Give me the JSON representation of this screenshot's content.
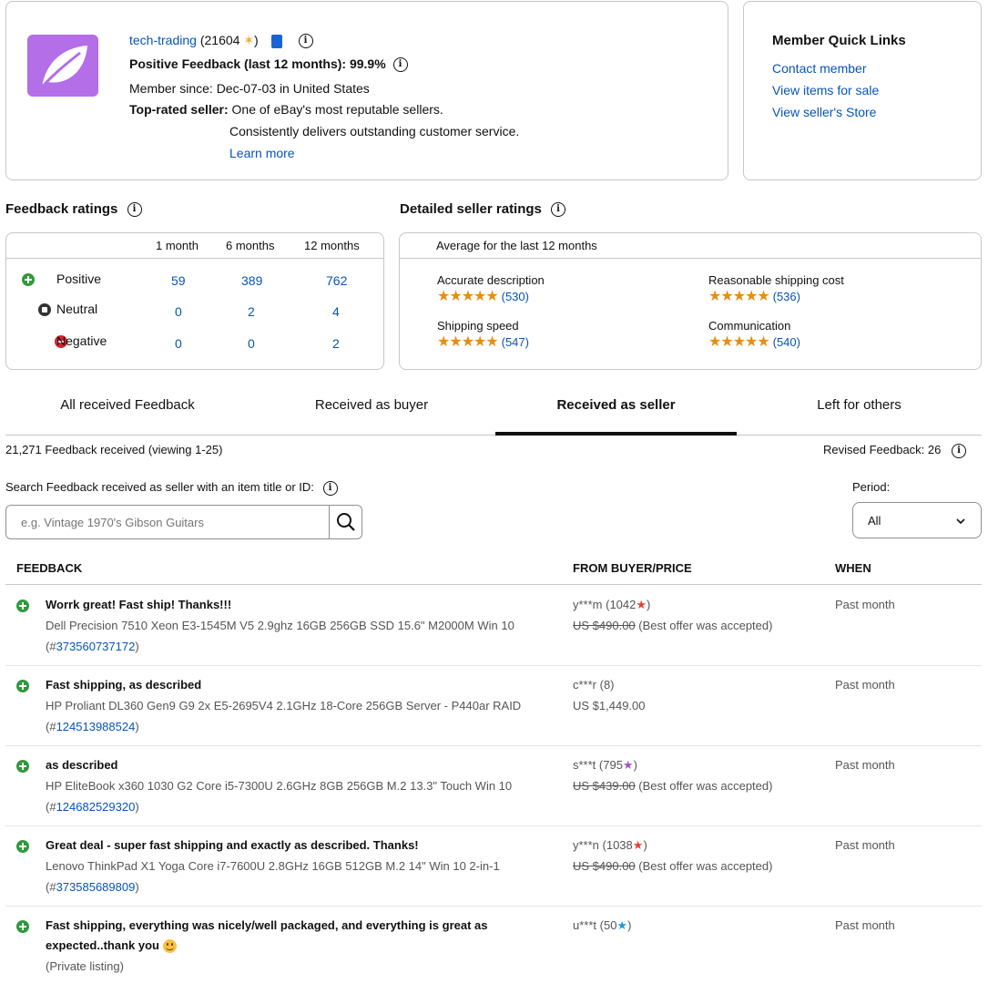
{
  "profile": {
    "username": "tech-trading",
    "score": "(21604",
    "score_close": ")",
    "positive_feedback": "Positive Feedback (last 12 months): 99.9%",
    "member_since": "Member since: Dec-07-03 in United States",
    "top_rated_label": "Top-rated seller:",
    "top_rated_line1": "One of eBay's most reputable sellers.",
    "top_rated_line2": "Consistently delivers outstanding customer service.",
    "learn_more": "Learn more",
    "avatar_color": "#b36ee8"
  },
  "quick_links": {
    "title": "Member Quick Links",
    "items": [
      "Contact member",
      "View items for sale",
      "View seller's Store"
    ]
  },
  "feedback_ratings": {
    "title": "Feedback ratings",
    "columns": [
      "1 month",
      "6 months",
      "12 months"
    ],
    "rows": [
      {
        "label": "Positive",
        "values": [
          "59",
          "389",
          "762"
        ]
      },
      {
        "label": "Neutral",
        "values": [
          "0",
          "2",
          "4"
        ]
      },
      {
        "label": "Negative",
        "values": [
          "0",
          "0",
          "2"
        ]
      }
    ]
  },
  "detailed_ratings": {
    "title": "Detailed seller ratings",
    "subtitle": "Average for the last 12 months",
    "items": [
      {
        "label": "Accurate description",
        "count": "(530)",
        "stars": 5
      },
      {
        "label": "Reasonable shipping cost",
        "count": "(536)",
        "stars": 5
      },
      {
        "label": "Shipping speed",
        "count": "(547)",
        "stars": 5
      },
      {
        "label": "Communication",
        "count": "(540)",
        "stars": 5
      }
    ]
  },
  "tabs": [
    "All received Feedback",
    "Received as buyer",
    "Received as seller",
    "Left for others"
  ],
  "active_tab": "Received as seller",
  "summary": {
    "count_text": "21,271 Feedback received (viewing 1-25)",
    "revised": "Revised Feedback: 26"
  },
  "search": {
    "label": "Search Feedback received as seller with an item title or ID:",
    "placeholder": "e.g. Vintage 1970's Gibson Guitars",
    "period_label": "Period:",
    "period_value": "All"
  },
  "table": {
    "headers": [
      "FEEDBACK",
      "FROM BUYER/PRICE",
      "WHEN"
    ],
    "rows": [
      {
        "comment": "Worrk great! Fast ship! Thanks!!!",
        "item": "Dell Precision 7510 Xeon E3-1545M V5 2.9ghz 16GB 256GB SSD 15.6\" M2000M Win 10",
        "item_prefix": "(#",
        "item_id": "373560737172",
        "item_suffix": ")",
        "buyer": "y***m (1042",
        "buyer_close": ")",
        "star_color": "#e8412f",
        "price": "US $490.00",
        "price_note": "(Best offer was accepted)",
        "when": "Past month"
      },
      {
        "comment": "Fast shipping, as described",
        "item": "HP Proliant DL360 Gen9 G9 2x E5-2695V4 2.1GHz 18-Core 256GB Server - P440ar RAID",
        "item_prefix": "(#",
        "item_id": "124513988524",
        "item_suffix": ")",
        "buyer": "c***r (8)",
        "price_plain": "US $1,449.00",
        "when": "Past month"
      },
      {
        "comment": "as described",
        "item": "HP EliteBook x360 1030 G2 Core i5-7300U 2.6GHz 8GB 256GB M.2 13.3\" Touch Win 10",
        "item_prefix": "(#",
        "item_id": "124682529320",
        "item_suffix": ")",
        "buyer": "s***t (795",
        "buyer_close": ")",
        "star_color": "#a550c8",
        "price": "US $439.00",
        "price_note": "(Best offer was accepted)",
        "when": "Past month"
      },
      {
        "comment": "Great deal - super fast shipping and exactly as described. Thanks!",
        "item": "Lenovo ThinkPad X1 Yoga Core i7-7600U 2.8GHz 16GB 512GB M.2 14\" Win 10 2-in-1",
        "item_prefix": "(#",
        "item_id": "373585689809",
        "item_suffix": ")",
        "buyer": "y***n (1038",
        "buyer_close": ")",
        "star_color": "#e8412f",
        "price": "US $490.00",
        "price_note": "(Best offer was accepted)",
        "when": "Past month"
      },
      {
        "comment_line1": "Fast shipping, everything was nicely/well packaged, and everything is great as",
        "comment_line2": "expected..thank you",
        "item_private": "(Private listing)",
        "buyer": "u***t (50",
        "buyer_close": ")",
        "star_color": "#1e9bd6",
        "when": "Past month"
      }
    ]
  }
}
